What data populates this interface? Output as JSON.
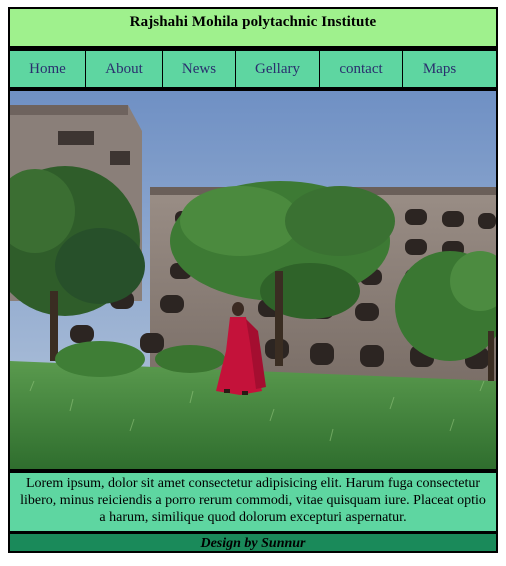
{
  "header": {
    "title": "Rajshahi Mohila polytachnic Institute"
  },
  "nav": {
    "items": [
      {
        "label": "Home"
      },
      {
        "label": "About"
      },
      {
        "label": "News"
      },
      {
        "label": "Gellary"
      },
      {
        "label": "contact"
      },
      {
        "label": "Maps"
      }
    ]
  },
  "hero": {
    "image": "photo-woman-in-red-saree-in-front-of-institute-building"
  },
  "description": {
    "text": "Lorem ipsum, dolor sit amet consectetur adipisicing elit. Harum fuga consectetur libero, minus reiciendis a porro rerum commodi, vitae quisquam iure. Placeat optio a harum, similique quod dolorum excepturi aspernatur."
  },
  "footer": {
    "text": "Design by Sunnur"
  },
  "colors": {
    "header_bg": "#9ff18d",
    "nav_bg": "#5ed6a1",
    "nav_text": "#2a2e6e",
    "footer_bg": "#1a8a5a"
  }
}
